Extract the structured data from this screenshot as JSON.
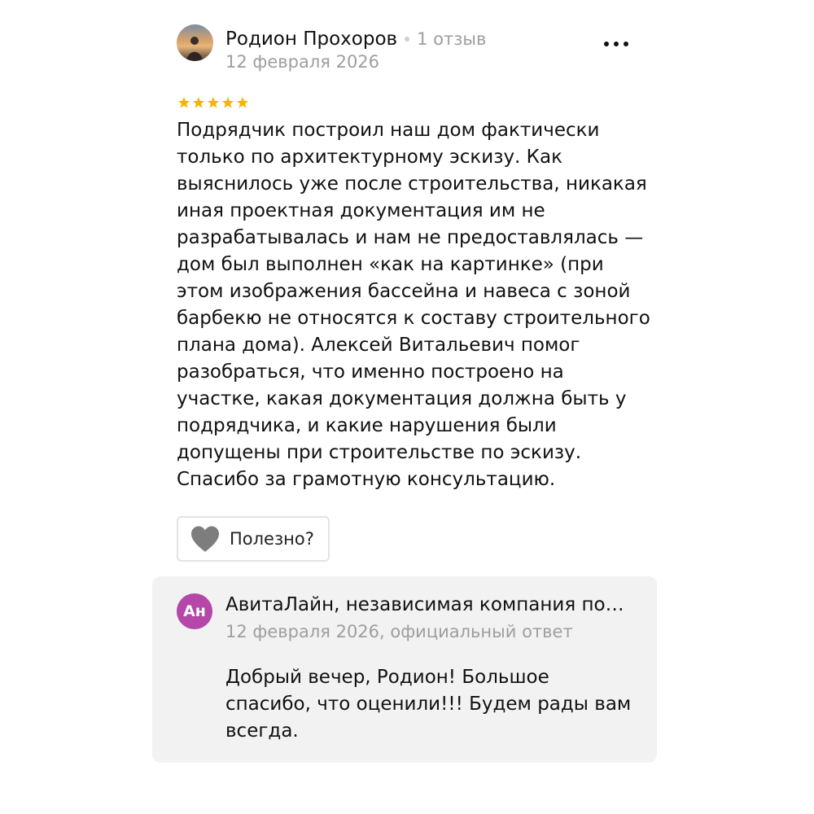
{
  "review": {
    "author_name": "Родион Прохоров",
    "review_count": "1 отзыв",
    "date": "12 февраля 2026",
    "rating": 5,
    "star_color": "#f5b400",
    "text_lines": [
      "Подрядчик построил наш дом фактически",
      "только по архитектурному эскизу. Как",
      "выяснилось уже после строительства, никакая",
      "иная проектная документация им не",
      "разрабатывалась и нам не предоставлялась —",
      "дом был выполнен «как на картинке» (при",
      "этом изображения бассейна и навеса с зоной",
      "барбекю не относятся к составу строительного",
      "плана дома). Алексей Витальевич помог",
      "разобраться, что именно построено на",
      "участке, какая документация должна быть у",
      "подрядчика, и какие нарушения были",
      "допущены при строительстве по эскизу.",
      "Спасибо за грамотную консультацию."
    ],
    "useful_label": "Полезно?",
    "more_icon": "more-dots-icon",
    "useful_icon": "heart-icon"
  },
  "reply": {
    "avatar_initials": "Ан",
    "avatar_color": "#b447a8",
    "author_name": "АвитаЛайн, независимая компания по…",
    "meta": "12 февраля 2026, официальный ответ",
    "text_lines": [
      "Добрый вечер, Родион! Большое",
      "спасибо, что оценили!!! Будем рады вам",
      "всегда."
    ]
  }
}
